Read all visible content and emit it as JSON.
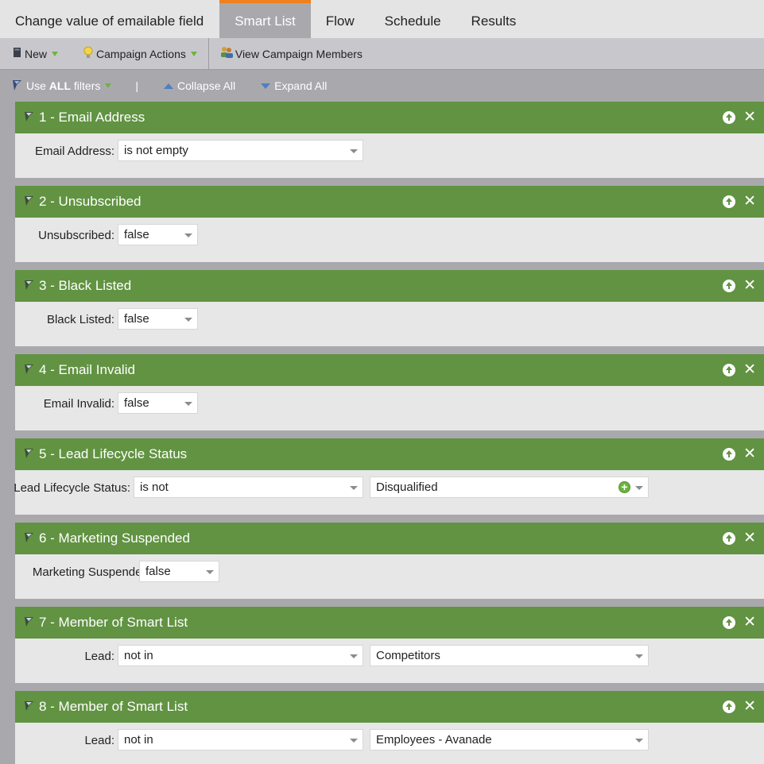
{
  "tabs": [
    {
      "label": "Change value of emailable field"
    },
    {
      "label": "Smart List"
    },
    {
      "label": "Flow"
    },
    {
      "label": "Schedule"
    },
    {
      "label": "Results"
    }
  ],
  "active_tab": "Smart List",
  "toolbar": {
    "new_label": "New",
    "campaign_actions_label": "Campaign Actions",
    "view_members_label": "View Campaign Members"
  },
  "filter_toolbar": {
    "use_prefix": "Use ",
    "use_all": "ALL",
    "use_suffix": " filters",
    "separator": "|",
    "collapse_all": "Collapse All",
    "expand_all": "Expand All"
  },
  "filters": [
    {
      "title": "1 - Email Address",
      "label": "Email Address:",
      "operator": "is not empty"
    },
    {
      "title": "2 - Unsubscribed",
      "label": "Unsubscribed:",
      "operator": "false"
    },
    {
      "title": "3 - Black Listed",
      "label": "Black Listed:",
      "operator": "false"
    },
    {
      "title": "4 - Email Invalid",
      "label": "Email Invalid:",
      "operator": "false"
    },
    {
      "title": "5 - Lead Lifecycle Status",
      "label": "Lead Lifecycle Status:",
      "operator": "is not",
      "value": "Disqualified"
    },
    {
      "title": "6 - Marketing Suspended",
      "label": "Marketing Suspended:",
      "operator": "false"
    },
    {
      "title": "7 - Member of Smart List",
      "label": "Lead:",
      "operator": "not in",
      "value": "Competitors"
    },
    {
      "title": "8 - Member of Smart List",
      "label": "Lead:",
      "operator": "not in",
      "value": "Employees - Avanade"
    }
  ],
  "colors": {
    "filter_header": "#619342",
    "active_tab_accent": "#f07f1d",
    "page_bg": "#a9a9ad"
  },
  "icons": [
    "new-icon",
    "lightbulb-icon",
    "members-icon",
    "filter-grip-icon",
    "move-up-icon",
    "close-icon",
    "add-icon",
    "dropdown-arrow-icon"
  ]
}
